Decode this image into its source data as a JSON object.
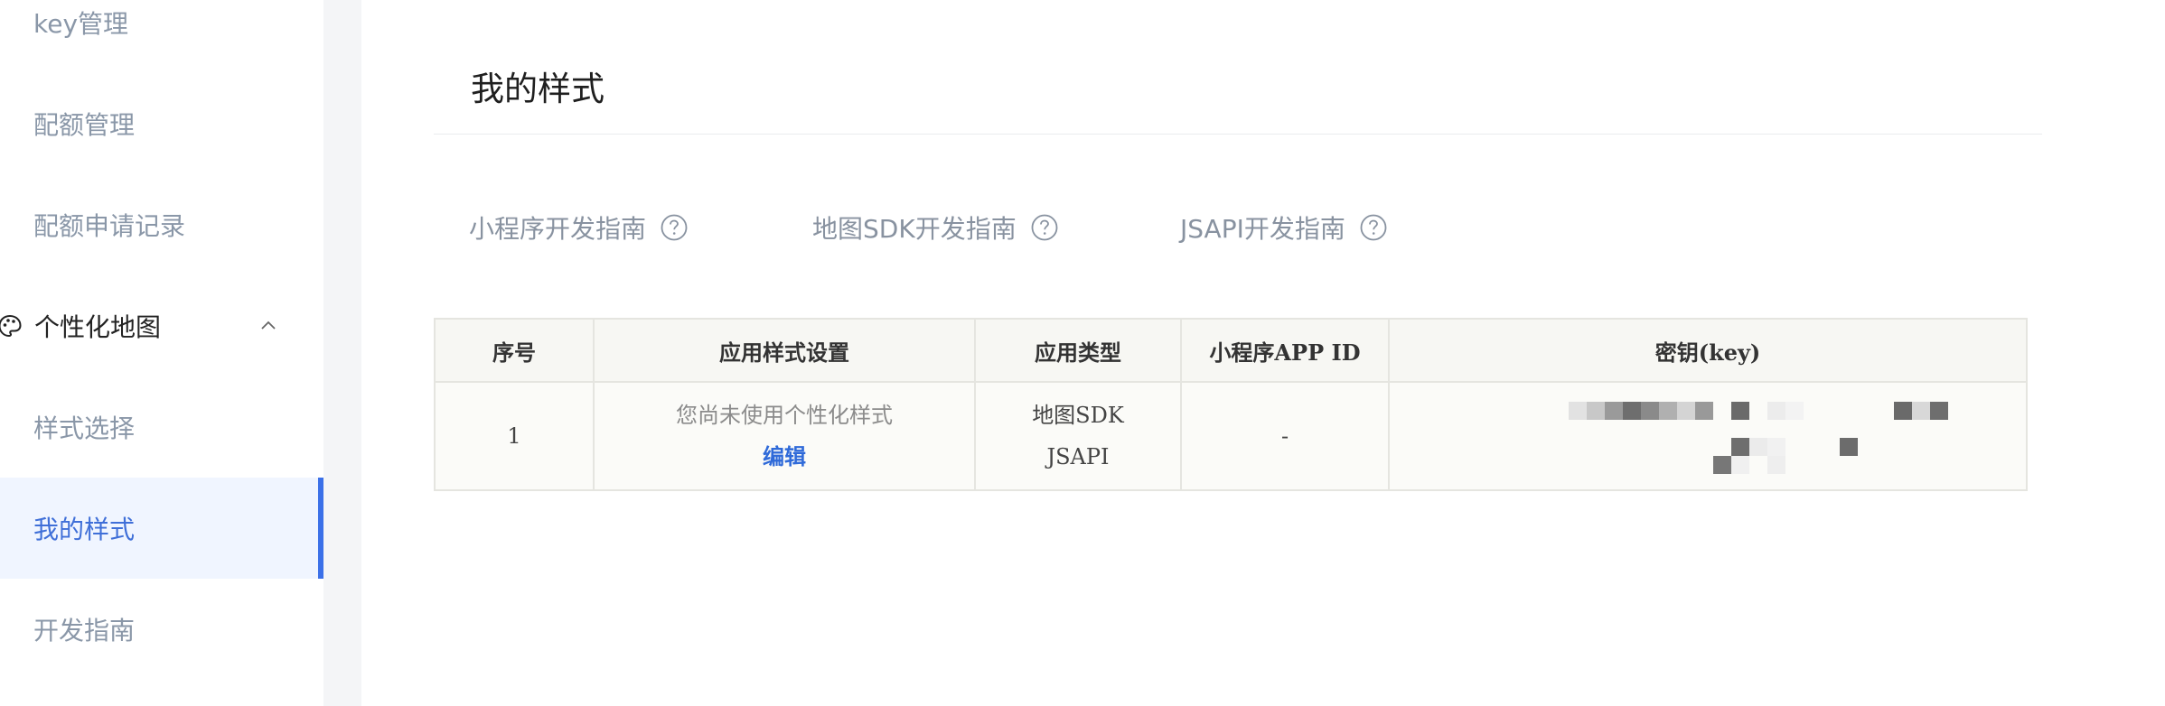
{
  "sidebar": {
    "items": [
      {
        "label": "key管理"
      },
      {
        "label": "配额管理"
      },
      {
        "label": "配额申请记录"
      }
    ],
    "group": {
      "label": "个性化地图",
      "icon": "palette-icon",
      "expand_icon": "chevron-up-icon"
    },
    "sub_items": [
      {
        "label": "样式选择"
      },
      {
        "label": "我的样式",
        "active": true
      },
      {
        "label": "开发指南"
      }
    ]
  },
  "main": {
    "title": "我的样式",
    "guides": [
      {
        "label": "小程序开发指南",
        "icon": "help-circle-icon"
      },
      {
        "label": "地图SDK开发指南",
        "icon": "help-circle-icon"
      },
      {
        "label": "JSAPI开发指南",
        "icon": "help-circle-icon"
      }
    ],
    "table": {
      "headers": [
        "序号",
        "应用样式设置",
        "应用类型",
        "小程序APP ID",
        "密钥(key)"
      ],
      "rows": [
        {
          "index": "1",
          "style_status": "您尚未使用个性化样式",
          "edit_label": "编辑",
          "app_types": [
            "地图SDK",
            "JSAPI"
          ],
          "mini_app_id": "-"
        }
      ]
    }
  },
  "colors": {
    "accent": "#3b70e8",
    "active_bg": "#f0f5ff",
    "link": "#2f6ad9",
    "sidebar_text": "#8a97a8"
  }
}
